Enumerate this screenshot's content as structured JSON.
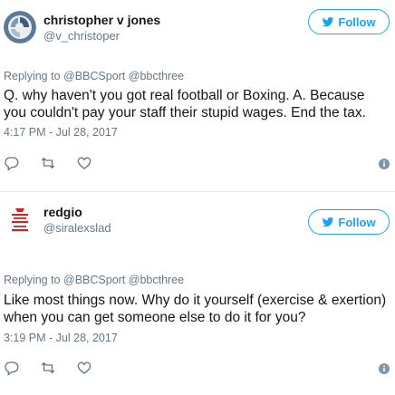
{
  "colors": {
    "accent": "#1da1f2",
    "text_primary": "#14171a",
    "text_secondary": "#657786",
    "divider": "#e6ecf0"
  },
  "tweets": [
    {
      "display_name": "christopher v jones",
      "handle": "@v_christoper",
      "follow_label": "Follow",
      "reply_to": "Replying to @BBCSport @bbcthree",
      "text": "Q. why haven't you got real football or Boxing. A. Because you couldn't pay your staff their stupid wages. End the tax.",
      "timestamp": "4:17 PM - Jul 28, 2017",
      "avatar_icon": "circular-logo-avatar",
      "actions": [
        "reply-icon",
        "retweet-icon",
        "like-icon"
      ]
    },
    {
      "display_name": "redgio",
      "handle": "@siralexslad",
      "follow_label": "Follow",
      "reply_to": "Replying to @BBCSport @bbcthree",
      "text": "Like most things now. Why do it yourself (exercise & exertion) when you can get someone else to do it for you?",
      "timestamp": "3:19 PM - Jul 28, 2017",
      "avatar_icon": "keep-calm-poster-avatar",
      "actions": [
        "reply-icon",
        "retweet-icon",
        "like-icon"
      ]
    }
  ]
}
